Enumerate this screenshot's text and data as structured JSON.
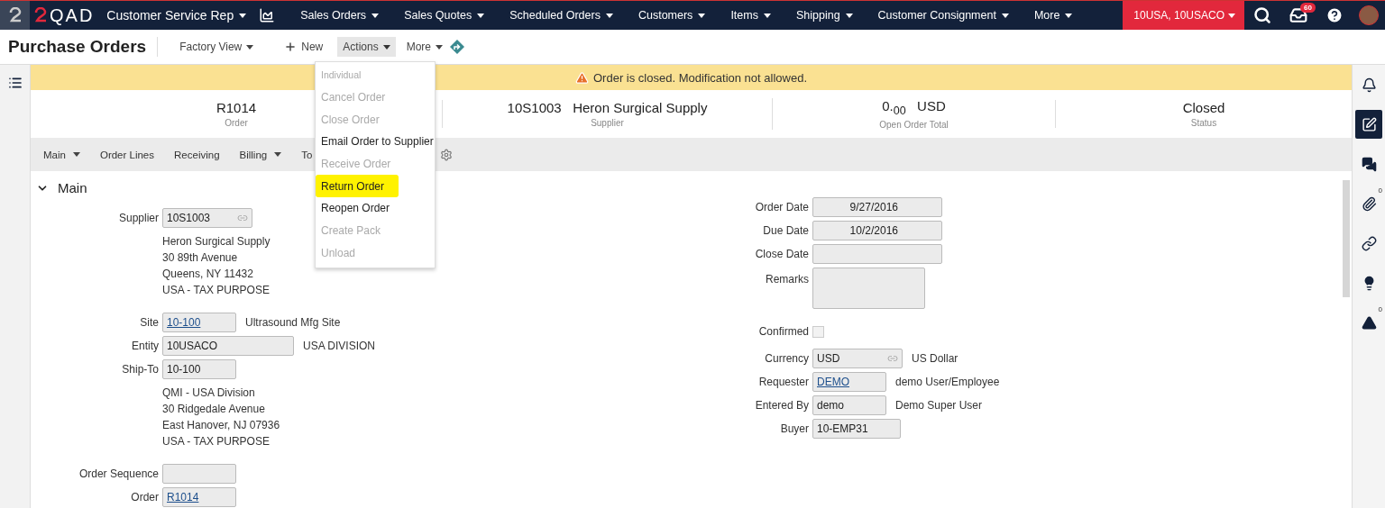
{
  "topbar": {
    "logo": "QAD",
    "role": "Customer Service Rep",
    "menus": [
      "Sales Orders",
      "Sales Quotes",
      "Scheduled Orders",
      "Customers",
      "Items",
      "Shipping",
      "Customer Consignment",
      "More"
    ],
    "domain": "10USA, 10USACO",
    "inbox_count": "60"
  },
  "page": {
    "title": "Purchase Orders",
    "view": "Factory View",
    "new": "New",
    "actions": "Actions",
    "more": "More"
  },
  "actions_menu": [
    {
      "kind": "header",
      "label": "Individual",
      "disabled": true,
      "highlighted": false
    },
    {
      "kind": "item",
      "label": "Cancel Order",
      "disabled": true,
      "highlighted": false
    },
    {
      "kind": "item",
      "label": "Close Order",
      "disabled": true,
      "highlighted": false
    },
    {
      "kind": "item",
      "label": "Email Order to Supplier",
      "disabled": false,
      "highlighted": false
    },
    {
      "kind": "item",
      "label": "Receive Order",
      "disabled": true,
      "highlighted": false
    },
    {
      "kind": "item",
      "label": "Return Order",
      "disabled": false,
      "highlighted": true
    },
    {
      "kind": "item",
      "label": "Reopen Order",
      "disabled": false,
      "highlighted": false
    },
    {
      "kind": "item",
      "label": "Create Pack",
      "disabled": true,
      "highlighted": false
    },
    {
      "kind": "item",
      "label": "Unload",
      "disabled": true,
      "highlighted": false
    }
  ],
  "banner": "Order is closed. Modification not allowed.",
  "summary": [
    {
      "value": "R1014",
      "caption": "Order"
    },
    {
      "value": "10S1003   Heron Surgical Supply",
      "caption": "Supplier"
    },
    {
      "value": "0.$_{00}$   USD",
      "caption": "Open Order Total"
    },
    {
      "value": "Closed",
      "caption": "Status"
    }
  ],
  "section_tabs": [
    {
      "label": "Main",
      "dropdown": true
    },
    {
      "label": "Order Lines",
      "dropdown": false
    },
    {
      "label": "Receiving",
      "dropdown": false
    },
    {
      "label": "Billing",
      "dropdown": true
    },
    {
      "label": "To",
      "dropdown": false
    }
  ],
  "section": {
    "title": "Main",
    "expanded": true
  },
  "left_fields": [
    {
      "kind": "lookup",
      "label": "Supplier",
      "value": "10S1003",
      "link": false
    },
    {
      "kind": "address",
      "lines": [
        "Heron Surgical Supply",
        "30 89th Avenue",
        "Queens, NY 11432",
        "USA - TAX PURPOSE"
      ]
    },
    {
      "kind": "short",
      "label": "Site",
      "value": "10-100",
      "link": true,
      "description": "Ultrasound Mfg Site"
    },
    {
      "kind": "long",
      "label": "Entity",
      "value": "10USACO",
      "link": false,
      "description": "USA DIVISION"
    },
    {
      "kind": "short",
      "label": "Ship-To",
      "value": "10-100",
      "link": false
    },
    {
      "kind": "address",
      "lines": [
        "QMI - USA Division",
        "30 Ridgedale Avenue",
        "East Hanover, NJ 07936",
        "USA - TAX PURPOSE"
      ]
    },
    {
      "kind": "short",
      "label": "Order Sequence"
    },
    {
      "kind": "short",
      "label": "Order",
      "value": "R1014",
      "link": true
    }
  ],
  "right_fields": [
    {
      "kind": "date",
      "label": "Order Date",
      "value": "9/27/2016"
    },
    {
      "kind": "date",
      "label": "Due Date",
      "value": "10/2/2016"
    },
    {
      "kind": "date",
      "label": "Close Date"
    },
    {
      "kind": "textarea",
      "label": "Remarks"
    },
    {
      "kind": "checkbox",
      "label": "Confirmed",
      "checked": false
    },
    {
      "kind": "lookup",
      "label": "Currency",
      "value": "USD",
      "link": false,
      "description": "US Dollar"
    },
    {
      "kind": "short",
      "label": "Requester",
      "value": "DEMO",
      "link": true,
      "description": "demo User/Employee"
    },
    {
      "kind": "short",
      "label": "Entered By",
      "value": "demo",
      "link": false,
      "description": "Demo Super User"
    },
    {
      "kind": "medium",
      "label": "Buyer",
      "value": "10-EMP31",
      "link": false
    }
  ],
  "right_rail": [
    {
      "kind": "bell",
      "selected": false
    },
    {
      "kind": "edit",
      "selected": true
    },
    {
      "kind": "chat",
      "selected": false
    },
    {
      "kind": "paperclip",
      "selected": false,
      "count": "0"
    },
    {
      "kind": "link",
      "selected": false
    },
    {
      "kind": "bulb",
      "selected": false
    },
    {
      "kind": "warning",
      "selected": false,
      "count": "0"
    }
  ]
}
